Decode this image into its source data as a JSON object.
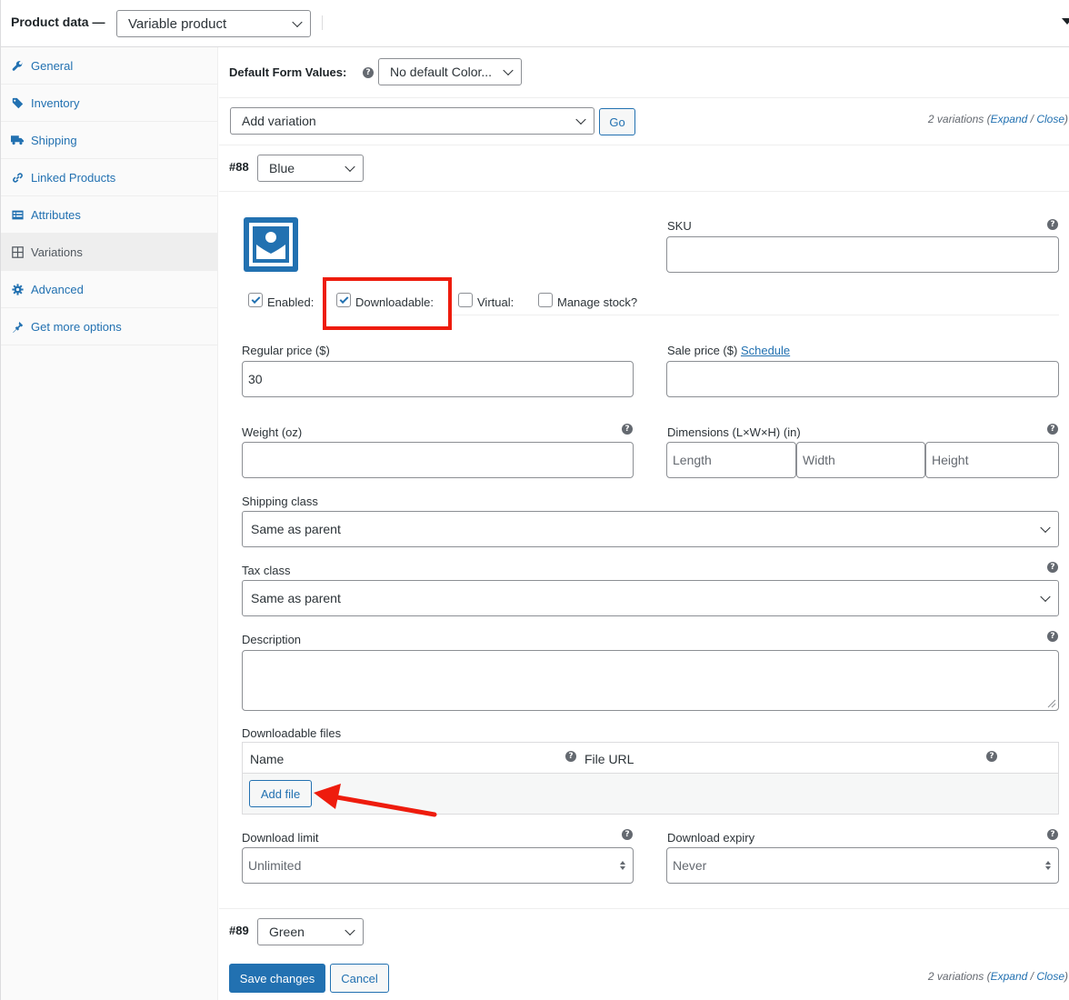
{
  "header": {
    "title": "Product data —",
    "product_type": "Variable product"
  },
  "sidebar": {
    "items": [
      {
        "label": "General",
        "icon": "wrench-icon"
      },
      {
        "label": "Inventory",
        "icon": "tag-icon"
      },
      {
        "label": "Shipping",
        "icon": "truck-icon"
      },
      {
        "label": "Linked Products",
        "icon": "link-icon"
      },
      {
        "label": "Attributes",
        "icon": "list-card-icon"
      },
      {
        "label": "Variations",
        "icon": "grid-icon",
        "active": true
      },
      {
        "label": "Advanced",
        "icon": "gear-icon"
      },
      {
        "label": "Get more options",
        "icon": "plugin-icon"
      }
    ]
  },
  "defaults": {
    "label": "Default Form Values:",
    "select_value": "No default Color..."
  },
  "toolbar": {
    "add_variation": "Add variation",
    "go_label": "Go",
    "count_prefix": "2 variations (",
    "expand": "Expand",
    "slash": " / ",
    "close": "Close",
    "count_suffix": ")"
  },
  "variation88": {
    "number": "#88",
    "color": "Blue",
    "sku_label": "SKU",
    "sku_value": "",
    "checkboxes": {
      "enabled": "Enabled:",
      "downloadable": "Downloadable:",
      "virtual": "Virtual:",
      "manage_stock": "Manage stock?"
    },
    "regular_price_label": "Regular price ($)",
    "regular_price_value": "30",
    "sale_price_label": "Sale price ($)",
    "schedule_link": "Schedule",
    "weight_label": "Weight (oz)",
    "dimensions_label": "Dimensions (L×W×H) (in)",
    "length_ph": "Length",
    "width_ph": "Width",
    "height_ph": "Height",
    "shipping_class_label": "Shipping class",
    "shipping_class_value": "Same as parent",
    "tax_class_label": "Tax class",
    "tax_class_value": "Same as parent",
    "description_label": "Description",
    "downloadable_files_label": "Downloadable files",
    "files_name_header": "Name",
    "files_url_header": "File URL",
    "add_file": "Add file",
    "download_limit_label": "Download limit",
    "download_limit_ph": "Unlimited",
    "download_expiry_label": "Download expiry",
    "download_expiry_ph": "Never"
  },
  "variation89": {
    "number": "#89",
    "color": "Green"
  },
  "footer": {
    "save": "Save changes",
    "cancel": "Cancel"
  },
  "colors": {
    "accent": "#2271b1",
    "highlight": "#ee1c0d"
  }
}
